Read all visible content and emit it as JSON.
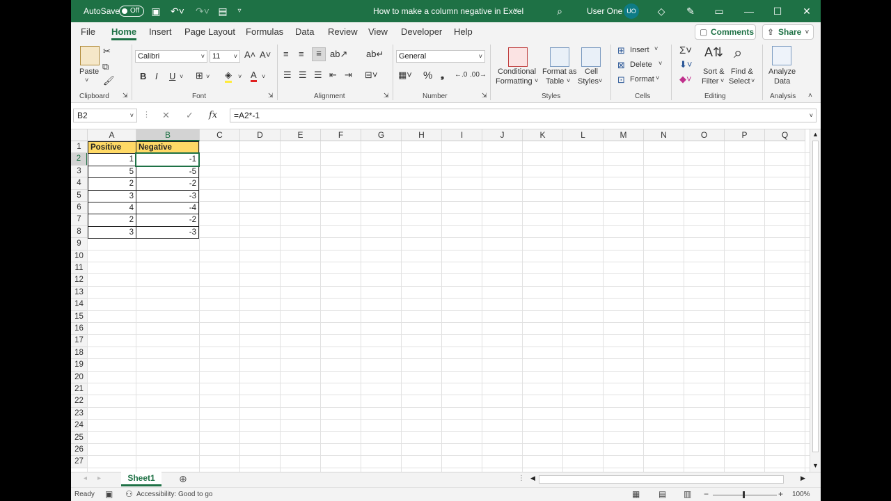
{
  "titlebar": {
    "autosave_label": "AutoSave",
    "autosave_state": "Off",
    "title": "How to make a column negative in Excel",
    "user_name": "User One",
    "user_initials": "UO"
  },
  "menu": {
    "tabs": [
      "File",
      "Home",
      "Insert",
      "Page Layout",
      "Formulas",
      "Data",
      "Review",
      "View",
      "Developer",
      "Help"
    ],
    "active_tab": "Home",
    "comments_label": "Comments",
    "share_label": "Share"
  },
  "ribbon": {
    "clipboard": {
      "paste": "Paste",
      "label": "Clipboard"
    },
    "font": {
      "name": "Calibri",
      "size": "11",
      "label": "Font"
    },
    "alignment": {
      "label": "Alignment"
    },
    "number": {
      "format": "General",
      "label": "Number"
    },
    "styles": {
      "conditional_1": "Conditional",
      "conditional_2": "Formatting",
      "format_table_1": "Format as",
      "format_table_2": "Table",
      "cell_styles_1": "Cell",
      "cell_styles_2": "Styles",
      "label": "Styles"
    },
    "cells": {
      "insert": "Insert",
      "delete": "Delete",
      "format": "Format",
      "label": "Cells"
    },
    "editing": {
      "sort_1": "Sort &",
      "sort_2": "Filter",
      "find_1": "Find &",
      "find_2": "Select",
      "label": "Editing"
    },
    "analysis": {
      "analyze_1": "Analyze",
      "analyze_2": "Data",
      "label": "Analysis"
    }
  },
  "formula_bar": {
    "name_box": "B2",
    "fx": "fx",
    "formula": "=A2*-1"
  },
  "sheet": {
    "columns": [
      "A",
      "B",
      "C",
      "D",
      "E",
      "F",
      "G",
      "H",
      "I",
      "J",
      "K",
      "L",
      "M",
      "N",
      "O",
      "P",
      "Q"
    ],
    "rows": [
      "1",
      "2",
      "3",
      "4",
      "5",
      "6",
      "7",
      "8",
      "9",
      "10",
      "11",
      "12",
      "13",
      "14",
      "15",
      "16",
      "17",
      "18",
      "19",
      "20",
      "21",
      "22",
      "23",
      "24",
      "25",
      "26",
      "27"
    ],
    "headers": {
      "a1": "Positive",
      "b1": "Negative"
    },
    "data": [
      {
        "positive": "1",
        "negative": "-1"
      },
      {
        "positive": "5",
        "negative": "-5"
      },
      {
        "positive": "2",
        "negative": "-2"
      },
      {
        "positive": "3",
        "negative": "-3"
      },
      {
        "positive": "4",
        "negative": "-4"
      },
      {
        "positive": "2",
        "negative": "-2"
      },
      {
        "positive": "3",
        "negative": "-3"
      }
    ],
    "active_cell": "B2"
  },
  "sheet_tabs": {
    "active": "Sheet1"
  },
  "status": {
    "ready": "Ready",
    "accessibility": "Accessibility: Good to go",
    "zoom": "100%"
  },
  "colors": {
    "brand": "#1e7145",
    "header_fill": "#ffd966"
  }
}
